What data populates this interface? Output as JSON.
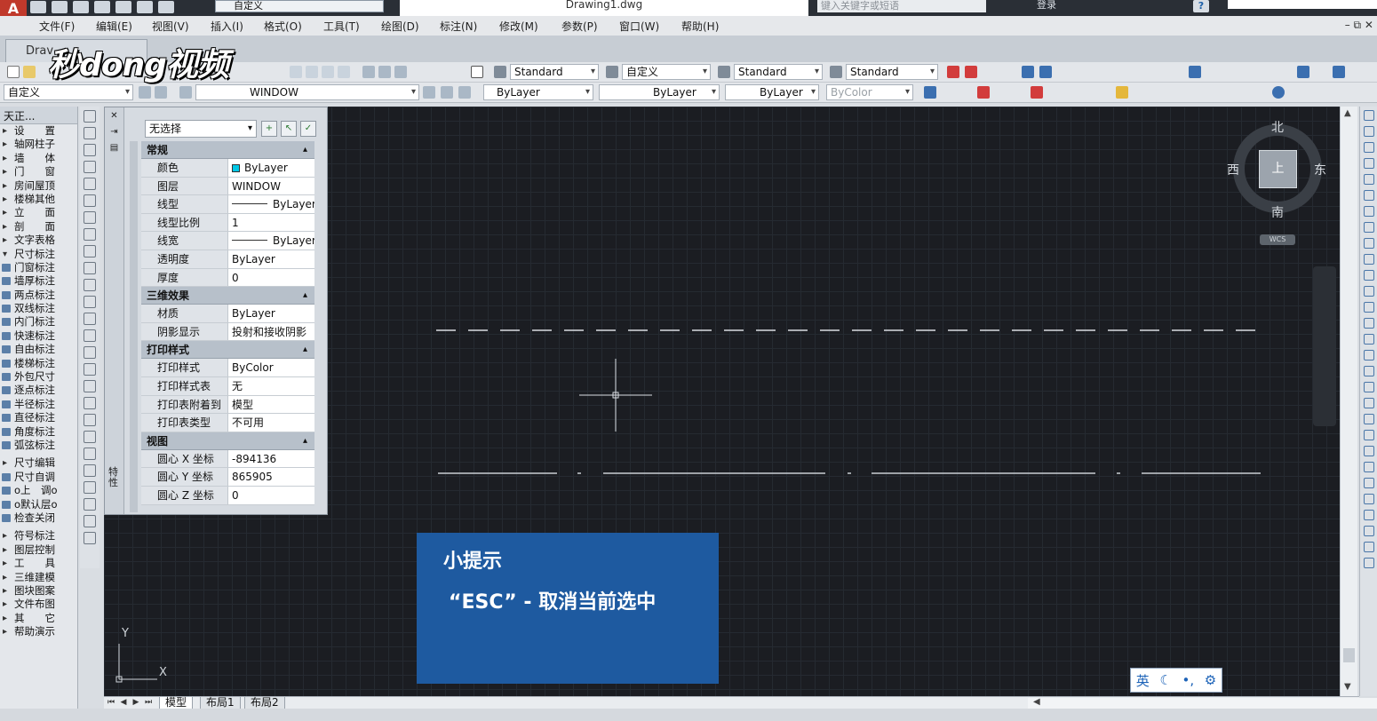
{
  "app": {
    "document_title": "Drawing1.dwg",
    "workspace": "自定义",
    "search_placeholder": "键入关键字或短语",
    "login_label": "登录",
    "help_label": "?",
    "mdi_controls": "– ⧉ ✕"
  },
  "menu": [
    "文件(F)",
    "编辑(E)",
    "视图(V)",
    "插入(I)",
    "格式(O)",
    "工具(T)",
    "绘图(D)",
    "标注(N)",
    "修改(M)",
    "参数(P)",
    "窗口(W)",
    "帮助(H)"
  ],
  "doc_tab": "Drav",
  "watermark": "秒dong视频",
  "toolbar1": {
    "text_style": "Standard",
    "annotation": "自定义",
    "dim_style": "Standard",
    "table_style": "Standard"
  },
  "toolbar2": {
    "workspace": "自定义",
    "layer": "WINDOW",
    "color": "ByLayer",
    "linetype": "ByLayer",
    "lineweight": "ByLayer",
    "plotstyle": "ByColor"
  },
  "tianzheng": {
    "header": "天正...",
    "items": [
      {
        "label": "设　　置",
        "kind": "arrow"
      },
      {
        "label": "轴网柱子",
        "kind": "arrow"
      },
      {
        "label": "墙　　体",
        "kind": "arrow"
      },
      {
        "label": "门　　窗",
        "kind": "arrow"
      },
      {
        "label": "房间屋顶",
        "kind": "arrow"
      },
      {
        "label": "楼梯其他",
        "kind": "arrow"
      },
      {
        "label": "立　　面",
        "kind": "arrow"
      },
      {
        "label": "剖　　面",
        "kind": "arrow"
      },
      {
        "label": "文字表格",
        "kind": "arrow"
      },
      {
        "label": "尺寸标注",
        "kind": "open"
      },
      {
        "label": "门窗标注",
        "kind": "tool"
      },
      {
        "label": "墙厚标注",
        "kind": "tool"
      },
      {
        "label": "两点标注",
        "kind": "tool"
      },
      {
        "label": "双线标注",
        "kind": "tool"
      },
      {
        "label": "内门标注",
        "kind": "tool"
      },
      {
        "label": "快速标注",
        "kind": "tool"
      },
      {
        "label": "自由标注",
        "kind": "tool"
      },
      {
        "label": "楼梯标注",
        "kind": "tool"
      },
      {
        "label": "外包尺寸",
        "kind": "tool"
      },
      {
        "label": "逐点标注",
        "kind": "tool"
      },
      {
        "label": "半径标注",
        "kind": "tool"
      },
      {
        "label": "直径标注",
        "kind": "tool"
      },
      {
        "label": "角度标注",
        "kind": "tool"
      },
      {
        "label": "弧弦标注",
        "kind": "tool"
      },
      {
        "label": "尺寸编辑",
        "kind": "arrow"
      },
      {
        "label": "尺寸自调",
        "kind": "tool"
      },
      {
        "label": "o上　调o",
        "kind": "tool"
      },
      {
        "label": "o默认层o",
        "kind": "tool"
      },
      {
        "label": "检查关闭",
        "kind": "tool"
      },
      {
        "label": "符号标注",
        "kind": "arrow"
      },
      {
        "label": "图层控制",
        "kind": "arrow"
      },
      {
        "label": "工　　具",
        "kind": "arrow"
      },
      {
        "label": "三维建模",
        "kind": "arrow"
      },
      {
        "label": "图块图案",
        "kind": "arrow"
      },
      {
        "label": "文件布图",
        "kind": "arrow"
      },
      {
        "label": "其　　它",
        "kind": "arrow"
      },
      {
        "label": "帮助演示",
        "kind": "arrow"
      }
    ]
  },
  "properties": {
    "selection": "无选择",
    "vertical_title": "特性",
    "sections": [
      {
        "title": "常规",
        "rows": [
          {
            "key": "颜色",
            "value": "ByLayer",
            "style": "swatch"
          },
          {
            "key": "图层",
            "value": "WINDOW"
          },
          {
            "key": "线型",
            "value": "ByLayer",
            "style": "line"
          },
          {
            "key": "线型比例",
            "value": "1"
          },
          {
            "key": "线宽",
            "value": "ByLayer",
            "style": "line"
          },
          {
            "key": "透明度",
            "value": "ByLayer"
          },
          {
            "key": "厚度",
            "value": "0"
          }
        ]
      },
      {
        "title": "三维效果",
        "rows": [
          {
            "key": "材质",
            "value": "ByLayer"
          },
          {
            "key": "阴影显示",
            "value": "投射和接收阴影"
          }
        ]
      },
      {
        "title": "打印样式",
        "rows": [
          {
            "key": "打印样式",
            "value": "ByColor"
          },
          {
            "key": "打印样式表",
            "value": "无"
          },
          {
            "key": "打印表附着到",
            "value": "模型"
          },
          {
            "key": "打印表类型",
            "value": "不可用"
          }
        ]
      },
      {
        "title": "视图",
        "rows": [
          {
            "key": "圆心 X 坐标",
            "value": "-894136"
          },
          {
            "key": "圆心 Y 坐标",
            "value": "865905"
          },
          {
            "key": "圆心 Z 坐标",
            "value": "0"
          }
        ]
      }
    ]
  },
  "compass": {
    "north": "北",
    "south": "南",
    "east": "东",
    "west": "西",
    "face": "上",
    "wcs": "WCS"
  },
  "hint": {
    "title": "小提示",
    "text": "“ESC” - 取消当前选中"
  },
  "ucs": {
    "x": "X",
    "y": "Y"
  },
  "ime": {
    "lang": "英",
    "moon": "☾",
    "punct": "•,",
    "settings": "⚙"
  },
  "layout_tabs": [
    "模型",
    "布局1",
    "布局2"
  ],
  "colors": {
    "canvas": "#1b1d22",
    "hint_bg": "#1e5aa0",
    "accent_red": "#c0392b"
  }
}
